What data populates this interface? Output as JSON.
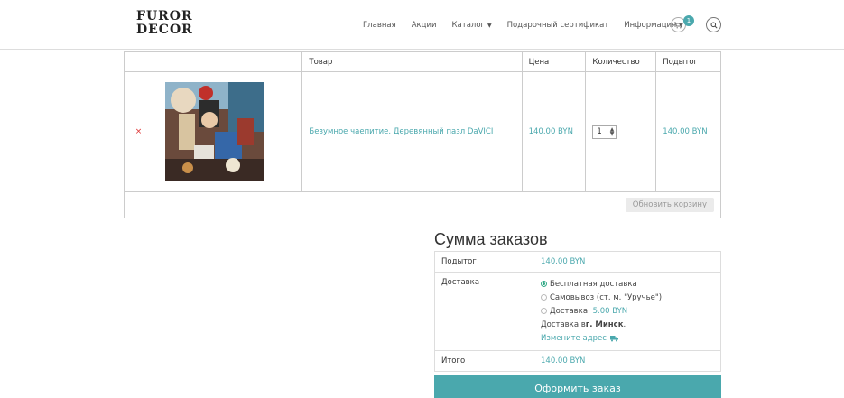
{
  "header": {
    "logo_line1": "FUROR",
    "logo_line2": "DECOR",
    "nav": [
      {
        "label": "Главная",
        "dropdown": false
      },
      {
        "label": "Акции",
        "dropdown": false
      },
      {
        "label": "Каталог",
        "dropdown": true
      },
      {
        "label": "Подарочный сертификат",
        "dropdown": false
      },
      {
        "label": "Информация",
        "dropdown": true
      }
    ],
    "cart_count": "1"
  },
  "cart": {
    "columns": [
      "",
      "",
      "Товар",
      "Цена",
      "Количество",
      "Подытог"
    ],
    "items": [
      {
        "remove": "×",
        "name": "Безумное чаепитие. Деревянный пазл DaVICI",
        "price": "140.00 BYN",
        "quantity": "1",
        "subtotal": "140.00 BYN"
      }
    ],
    "update_label": "Обновить корзину"
  },
  "totals": {
    "title": "Сумма заказов",
    "subtotal_label": "Подытог",
    "subtotal_value": "140.00 BYN",
    "shipping_label": "Доставка",
    "shipping_options": [
      {
        "label": "Бесплатная доставка",
        "price": "",
        "selected": true
      },
      {
        "label": "Самовывоз (ст. м. \"Уручье\")",
        "price": "",
        "selected": false
      },
      {
        "label": "Доставка: ",
        "price": "5.00 BYN",
        "selected": false
      }
    ],
    "destination_prefix": "Доставка в ",
    "destination_city": "г. Минск",
    "destination_suffix": ".",
    "change_address": "Измените адрес",
    "total_label": "Итого",
    "total_value": "140.00 BYN",
    "checkout_label": "Оформить заказ"
  },
  "colors": {
    "accent": "#4aa8ad",
    "remove": "#dd3333"
  }
}
